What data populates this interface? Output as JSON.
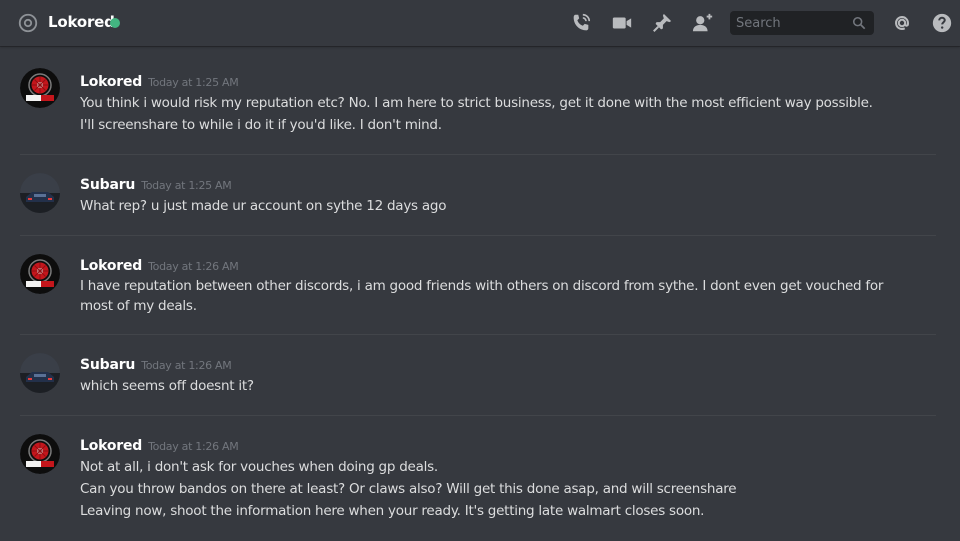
{
  "header": {
    "channel_name": "Lokored",
    "status": "online",
    "status_color": "#43b581",
    "icons": [
      "at-icon",
      "call-icon",
      "video-icon",
      "pin-icon",
      "add-friend-icon",
      "mention-icon",
      "help-icon"
    ]
  },
  "search": {
    "placeholder": "Search"
  },
  "messages": [
    {
      "author": "Lokored",
      "timestamp": "Today at 1:25 AM",
      "lines": [
        "You think i would risk my reputation etc? No. I am here to strict business, get it done with the most efficient way possible.",
        "I'll screenshare to while i do it if you'd like. I don't mind."
      ]
    },
    {
      "author": "Subaru",
      "timestamp": "Today at 1:25 AM",
      "lines": [
        "What rep? u just made ur account on sythe 12 days ago"
      ]
    },
    {
      "author": "Lokored",
      "timestamp": "Today at 1:26 AM",
      "lines": [
        "I have reputation between other discords, i am good friends with others on discord from sythe. I dont even get vouched for most of my deals."
      ]
    },
    {
      "author": "Subaru",
      "timestamp": "Today at 1:26 AM",
      "lines": [
        "which seems off doesnt it?"
      ]
    },
    {
      "author": "Lokored",
      "timestamp": "Today at 1:26 AM",
      "lines": [
        "Not at all, i don't ask for vouches when doing gp deals.",
        "Can you throw bandos on there at least? Or claws also? Will get this done asap, and will screenshare",
        "Leaving now, shoot the information here when your ready. It's getting late walmart closes soon."
      ]
    }
  ]
}
